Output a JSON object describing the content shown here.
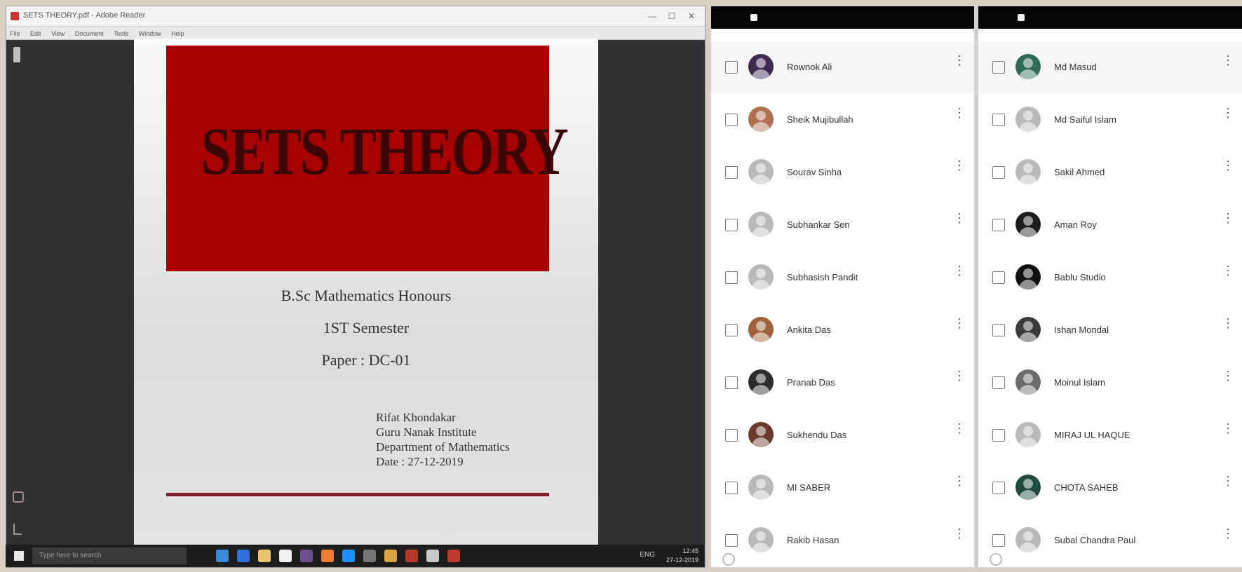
{
  "viewer": {
    "window_title": "SETS THEORY.pdf - Adobe Reader",
    "controls": {
      "minimize": "—",
      "maximize": "☐",
      "close": "✕"
    },
    "menu": [
      "File",
      "Edit",
      "View",
      "Document",
      "Tools",
      "Window",
      "Help"
    ]
  },
  "document": {
    "cover_title": "SETS THEORY",
    "degree": "B.Sc Mathematics Honours",
    "semester": "1ST Semester",
    "paper": "Paper : DC-01",
    "details": [
      "Rifat Khondakar",
      "Guru Nanak Institute",
      "Department of Mathematics",
      "Date : 27-12-2019"
    ]
  },
  "taskbar": {
    "search_placeholder": "Type here to search",
    "tray_text": "ENG",
    "clock_time": "12:45",
    "clock_date": "27-12-2019"
  },
  "contacts_left": [
    {
      "name": "Rownok Ali",
      "avatar_color": "#3d2b4f"
    },
    {
      "name": "Sheik Mujibullah",
      "avatar_color": "#b07050"
    },
    {
      "name": "Sourav Sinha",
      "avatar_color": "#b9b9b9"
    },
    {
      "name": "Subhankar Sen",
      "avatar_color": "#b9b9b9"
    },
    {
      "name": "Subhasish Pandit",
      "avatar_color": "#b9b9b9"
    },
    {
      "name": "Ankita Das",
      "avatar_color": "#a0623a"
    },
    {
      "name": "Pranab Das",
      "avatar_color": "#2c2c2c"
    },
    {
      "name": "Sukhendu Das",
      "avatar_color": "#6b3a2a"
    },
    {
      "name": "MI SABER",
      "avatar_color": "#b9b9b9"
    },
    {
      "name": "Rakib Hasan",
      "avatar_color": "#b9b9b9"
    }
  ],
  "contacts_right": [
    {
      "name": "Md Masud",
      "avatar_color": "#2e6b55"
    },
    {
      "name": "Md Saiful Islam",
      "avatar_color": "#b9b9b9"
    },
    {
      "name": "Sakil Ahmed",
      "avatar_color": "#b9b9b9"
    },
    {
      "name": "Aman Roy",
      "avatar_color": "#1c1c1c"
    },
    {
      "name": "Bablu Studio",
      "avatar_color": "#111111"
    },
    {
      "name": "Ishan Mondal",
      "avatar_color": "#3a3a3a"
    },
    {
      "name": "Moinul Islam",
      "avatar_color": "#6b6b6b"
    },
    {
      "name": "MIRAJ UL HAQUE",
      "avatar_color": "#b9b9b9"
    },
    {
      "name": "CHOTA SAHEB",
      "avatar_color": "#1f4a3f"
    },
    {
      "name": "Subal Chandra Paul",
      "avatar_color": "#b9b9b9"
    }
  ]
}
